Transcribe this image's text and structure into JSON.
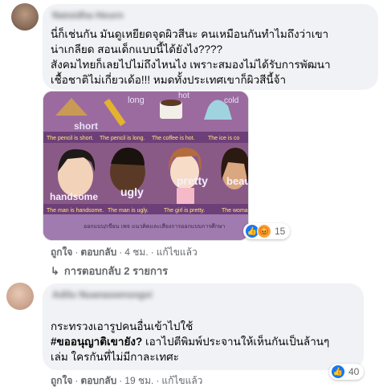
{
  "comments": [
    {
      "author": "Natsidha Heurn",
      "lines": [
        "นี่ก็เช่นกัน มันดูเหยียดจุดผิวสีนะ คนเหมือนกันทำไมถึงว่าเขา",
        "น่าเกลียด สอนเด็กแบบนี้ได้ยังไง????",
        "สังคมไทยก็เลยไปไม่ถึงไหนไง เพราะสมองไม่ได้รับการพัฒนา",
        "เชื้อชาติไม่เกี่ยวเด้อ!!! หมดทั้งประเทศเขาก็ผิวสีนี้จ้า"
      ],
      "reaction_count": "15",
      "actions": {
        "like": "ถูกใจ",
        "reply": "ตอบกลับ",
        "time": "4 ชม.",
        "edited": "แก้ไขแล้ว"
      },
      "replies_label": "การตอบกลับ 2 รายการ",
      "image": {
        "words": [
          "short",
          "long",
          "hot",
          "cold"
        ],
        "captions_top": [
          "The pencil is short.",
          "The pencil is long.",
          "The coffee is hot.",
          "The ice is co"
        ],
        "words2": [
          "handsome",
          "ugly",
          "pretty",
          "beau"
        ],
        "captions_bottom": [
          "The man is handsome.",
          "The man is ugly.",
          "The girl is pretty.",
          "The woma"
        ],
        "footer": "ออกแบบ/เขียน เพจ แนวคิดและเสียงการออกแบบการศึกษา"
      }
    },
    {
      "author": "Adilu Nuanaswnsngvi",
      "subtitle": "",
      "line1": "กระทรวงเอารูปคนอื่นเข้าไปใช้",
      "hashtag": "#ขออนุญาติเขายัง?",
      "line2_rest": " เอาไปตีพิมพ์ประจานให้เห็นกันเป็นล้านๆ",
      "line3": "เล่ม ใครกันที่ไม่มีกาละเทศะ",
      "reaction_count": "40",
      "actions": {
        "like": "ถูกใจ",
        "reply": "ตอบกลับ",
        "time": "19 ชม.",
        "edited": "แก้ไขแล้ว"
      }
    }
  ],
  "colors": {
    "bubble": "#f0f2f5",
    "like": "#1877f2",
    "angry": "#f7a53b",
    "meta": "#65676b"
  }
}
